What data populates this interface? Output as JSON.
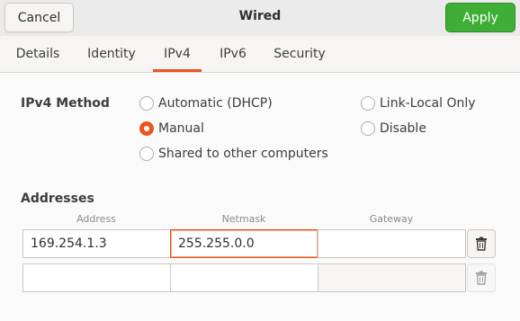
{
  "header": {
    "title": "Wired",
    "cancel_label": "Cancel",
    "apply_label": "Apply"
  },
  "tabs": [
    {
      "label": "Details"
    },
    {
      "label": "Identity"
    },
    {
      "label": "IPv4",
      "active": true
    },
    {
      "label": "IPv6"
    },
    {
      "label": "Security"
    }
  ],
  "ipv4": {
    "method_label": "IPv4 Method",
    "methods": [
      {
        "label": "Automatic (DHCP)",
        "selected": false
      },
      {
        "label": "Manual",
        "selected": true
      },
      {
        "label": "Shared to other computers",
        "selected": false
      },
      {
        "label": "Link-Local Only",
        "selected": false
      },
      {
        "label": "Disable",
        "selected": false
      }
    ]
  },
  "addresses": {
    "section_label": "Addresses",
    "columns": [
      "Address",
      "Netmask",
      "Gateway"
    ],
    "rows": [
      {
        "address": "169.254.1.3",
        "netmask": "255.255.0.0",
        "gateway": ""
      },
      {
        "address": "",
        "netmask": "",
        "gateway": ""
      }
    ]
  },
  "colors": {
    "accent": "#e95420",
    "apply_button": "#3eae37"
  },
  "icons": [
    "trash-icon"
  ]
}
